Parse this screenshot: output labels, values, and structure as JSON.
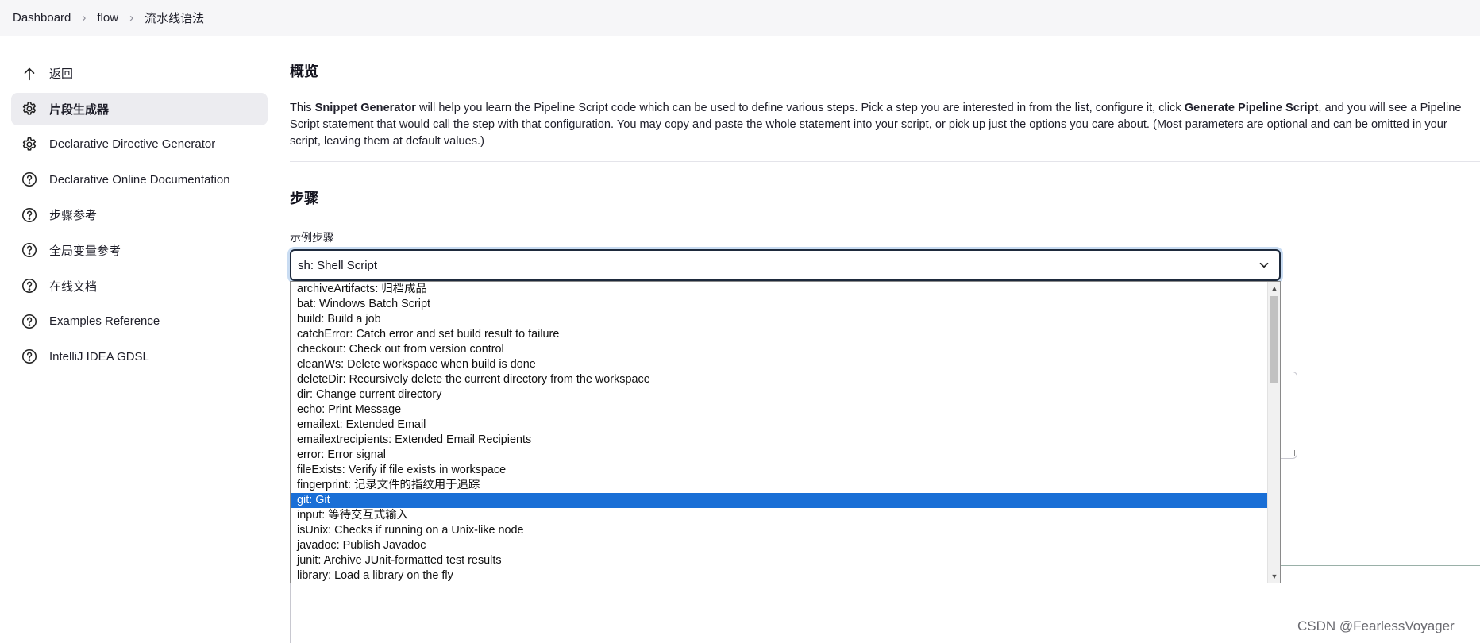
{
  "breadcrumb": {
    "items": [
      "Dashboard",
      "flow",
      "流水线语法"
    ]
  },
  "sidebar": {
    "items": [
      {
        "label": "返回",
        "icon": "arrow-up-icon"
      },
      {
        "label": "片段生成器",
        "icon": "gear-icon",
        "active": true
      },
      {
        "label": "Declarative Directive Generator",
        "icon": "gear-icon"
      },
      {
        "label": "Declarative Online Documentation",
        "icon": "help-icon"
      },
      {
        "label": "步骤参考",
        "icon": "help-icon"
      },
      {
        "label": "全局变量参考",
        "icon": "help-icon"
      },
      {
        "label": "在线文档",
        "icon": "help-icon"
      },
      {
        "label": "Examples Reference",
        "icon": "help-icon"
      },
      {
        "label": "IntelliJ IDEA GDSL",
        "icon": "help-icon"
      }
    ]
  },
  "main": {
    "overview_heading": "概览",
    "description": {
      "part1": "This ",
      "bold1": "Snippet Generator",
      "part2": " will help you learn the Pipeline Script code which can be used to define various steps. Pick a step you are interested in from the list, configure it, click ",
      "bold2": "Generate Pipeline Script",
      "part3": ", and you will see a Pipeline Script statement that would call the step with that configuration. You may copy and paste the whole statement into your script, or pick up just the options you care about. (Most parameters are optional and can be omitted in your script, leaving them at default values.)"
    },
    "steps_heading": "步骤",
    "sample_step_label": "示例步骤",
    "select_value": "sh: Shell Script",
    "options": [
      "archiveArtifacts: 归档成品",
      "bat: Windows Batch Script",
      "build: Build a job",
      "catchError: Catch error and set build result to failure",
      "checkout: Check out from version control",
      "cleanWs: Delete workspace when build is done",
      "deleteDir: Recursively delete the current directory from the workspace",
      "dir: Change current directory",
      "echo: Print Message",
      "emailext: Extended Email",
      "emailextrecipients: Extended Email Recipients",
      "error: Error signal",
      "fileExists: Verify if file exists in workspace",
      "fingerprint: 记录文件的指纹用于追踪",
      "git: Git",
      "input: 等待交互式输入",
      "isUnix: Checks if running on a Unix-like node",
      "javadoc: Publish Javadoc",
      "junit: Archive JUnit-formatted test results",
      "library: Load a library on the fly"
    ],
    "selected_option": "git: Git"
  },
  "watermark": "CSDN @FearlessVoyager",
  "colors": {
    "selected_option_bg": "#1a6fd6",
    "focus_ring": "#c9dcf2",
    "sidebar_active_bg": "#ececf0"
  }
}
